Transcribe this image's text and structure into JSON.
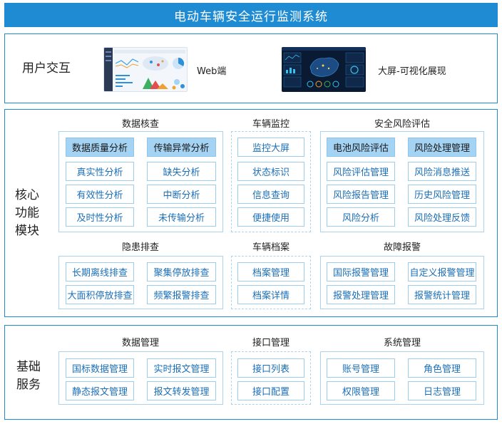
{
  "title": "电动车辆安全运行监测系统",
  "user_interaction": {
    "label": "用户交互",
    "web_label": "Web端",
    "bigscreen_label": "大屏-可视化展现"
  },
  "core": {
    "label": "核心\n功能\n模块",
    "data_check": {
      "title": "数据核查",
      "items": [
        "数据质量分析",
        "传输异常分析",
        "真实性分析",
        "缺失分析",
        "有效性分析",
        "中断分析",
        "及时性分析",
        "未传输分析"
      ]
    },
    "vehicle_monitor": {
      "title": "车辆监控",
      "items": [
        "监控大屏",
        "状态标识",
        "信息查询",
        "便捷使用"
      ]
    },
    "safety_risk": {
      "title": "安全风险评估",
      "items": [
        "电池风险评估",
        "风险处理管理",
        "风险评估管理",
        "风险消息推送",
        "风险报告管理",
        "历史风险管理",
        "风险分析",
        "风险处理反馈"
      ]
    },
    "hazard": {
      "title": "隐患排查",
      "items": [
        "长期离线排查",
        "聚集停放排查",
        "大面积停放排查",
        "频繁报警排查"
      ]
    },
    "vehicle_archive": {
      "title": "车辆档案",
      "items": [
        "档案管理",
        "档案详情"
      ]
    },
    "fault_alarm": {
      "title": "故障报警",
      "items": [
        "国际报警管理",
        "自定义报警管理",
        "报警处理管理",
        "报警统计管理"
      ]
    }
  },
  "base": {
    "label": "基础\n服务",
    "data_mgmt": {
      "title": "数据管理",
      "items": [
        "国标数据管理",
        "实时报文管理",
        "静态报文管理",
        "报文转发管理"
      ]
    },
    "interface_mgmt": {
      "title": "接口管理",
      "items": [
        "接口列表",
        "接口配置"
      ]
    },
    "system_mgmt": {
      "title": "系统管理",
      "items": [
        "账号管理",
        "角色管理",
        "权限管理",
        "日志管理"
      ]
    }
  },
  "colors": {
    "accent": "#1e8bd2",
    "box_text": "#1b6fb8",
    "header_fill": "#a4d3f3"
  }
}
